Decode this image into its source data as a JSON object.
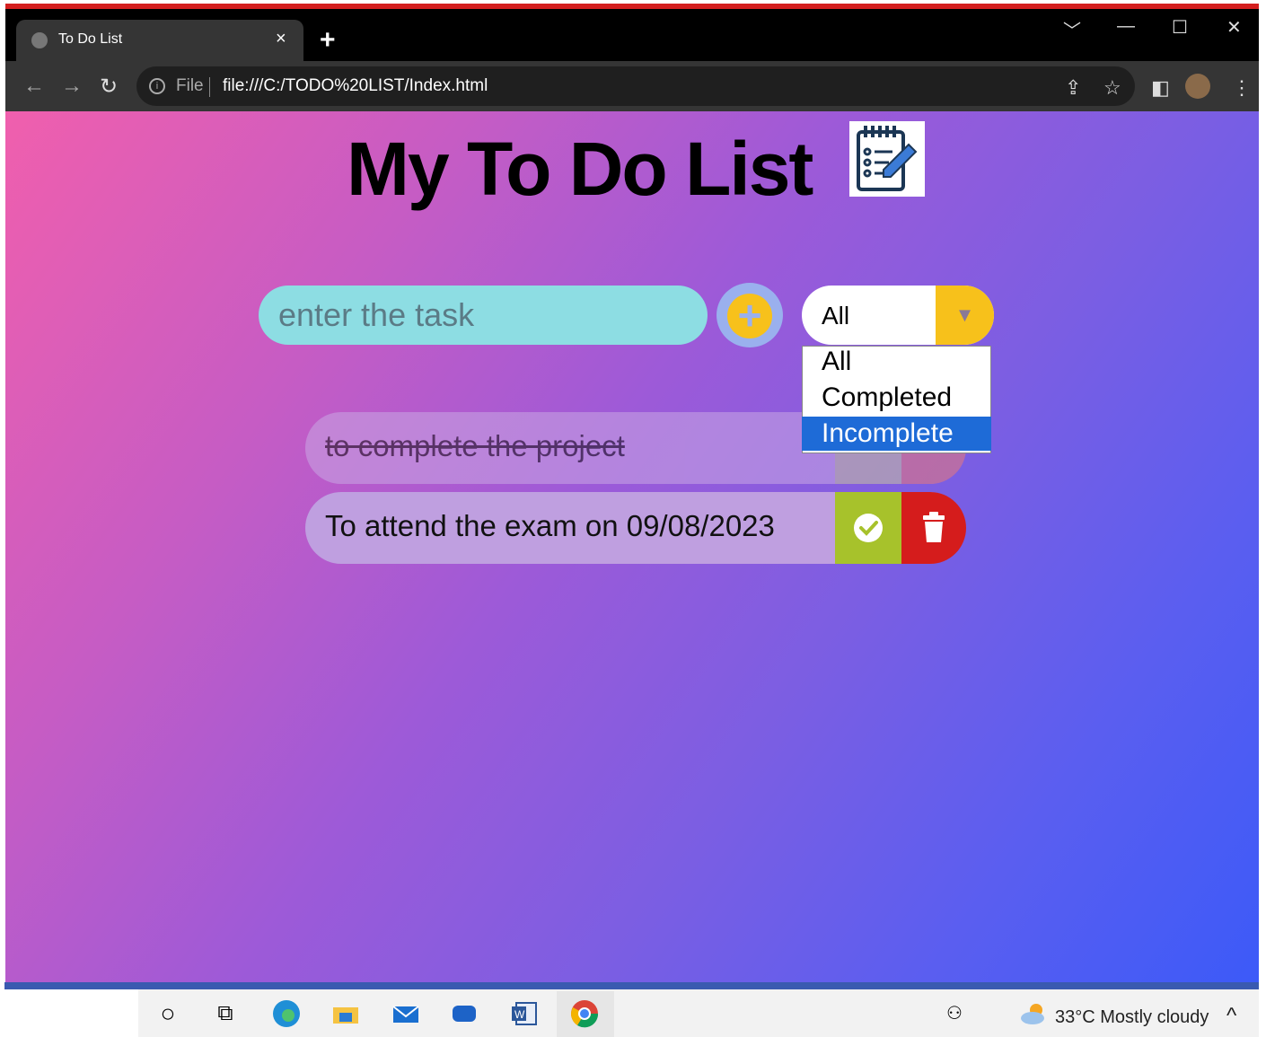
{
  "browser": {
    "tab_title": "To Do List",
    "new_tab": "+",
    "tab_close": "×",
    "file_label": "File",
    "url": "file:///C:/TODO%20LIST/Index.html",
    "window_controls": [
      "﹀",
      "—",
      "☐",
      "✕"
    ]
  },
  "page": {
    "title": "My To Do List",
    "input_placeholder": "enter the task",
    "filter": {
      "selected": "All",
      "options": [
        "All",
        "Completed",
        "Incomplete"
      ],
      "highlighted": "Incomplete"
    },
    "tasks": [
      {
        "text": "to complete the project",
        "completed": true
      },
      {
        "text": "To attend the exam on 09/08/2023",
        "completed": false
      }
    ]
  },
  "taskbar": {
    "weather": "33°C  Mostly cloudy",
    "tray_up": "^"
  },
  "colors": {
    "check": "#a7c22b",
    "trash": "#d51c1c",
    "add_button": "#f7c11b",
    "input": "#8ddde3",
    "selected_option": "#1e6bd7"
  }
}
